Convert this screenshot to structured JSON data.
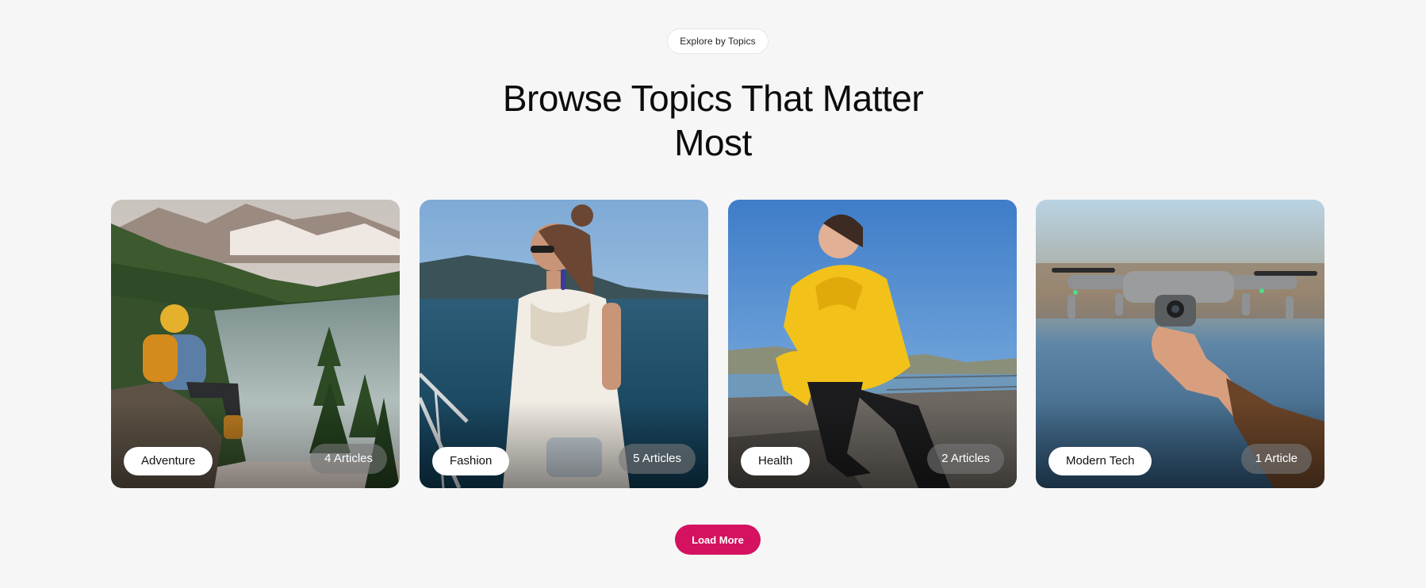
{
  "section": {
    "eyebrow": "Explore by Topics",
    "title_line1": "Browse Topics That Matter",
    "title_line2": "Most"
  },
  "topics": [
    {
      "name": "Adventure",
      "count": "4 Articles",
      "image": "hiker-at-mountain-lake"
    },
    {
      "name": "Fashion",
      "count": "5 Articles",
      "image": "woman-on-boat-by-sea"
    },
    {
      "name": "Health",
      "count": "2 Articles",
      "image": "woman-stretching-yellow-hoodie"
    },
    {
      "name": "Modern Tech",
      "count": "1 Article",
      "image": "hand-holding-drone"
    }
  ],
  "actions": {
    "load_more_label": "Load More"
  },
  "colors": {
    "background": "#f6f6f6",
    "accent": "#d4125f"
  }
}
